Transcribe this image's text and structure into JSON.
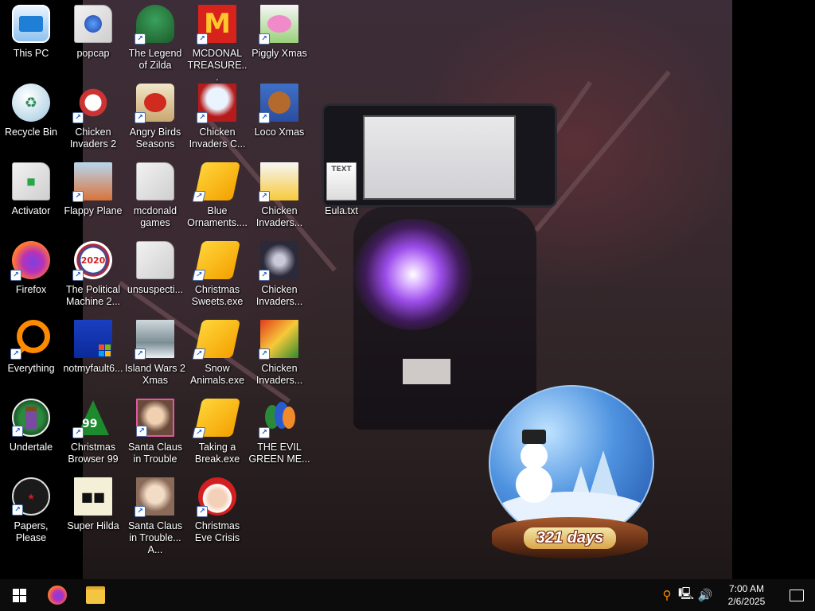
{
  "desktop": {
    "icons": [
      {
        "label": "This PC",
        "icon": "computer-icon"
      },
      {
        "label": "Recycle Bin",
        "icon": "recycle-bin-icon"
      },
      {
        "label": "Activator",
        "icon": "file-icon"
      },
      {
        "label": "Firefox",
        "icon": "firefox-icon"
      },
      {
        "label": "Everything",
        "icon": "search-icon"
      },
      {
        "label": "Undertale",
        "icon": "game-icon"
      },
      {
        "label": "Papers, Please",
        "icon": "game-icon"
      },
      {
        "label": "popcap",
        "icon": "file-icon"
      },
      {
        "label": "Chicken Invaders 2",
        "icon": "game-icon"
      },
      {
        "label": "Flappy Plane",
        "icon": "game-icon"
      },
      {
        "label": "The Political Machine 2...",
        "icon": "game-icon"
      },
      {
        "label": "notmyfault6...",
        "icon": "app-icon"
      },
      {
        "label": "Christmas Browser 99",
        "icon": "tree-icon"
      },
      {
        "label": "Super Hilda",
        "icon": "game-icon"
      },
      {
        "label": "The Legend of Zilda",
        "icon": "game-icon"
      },
      {
        "label": "Angry Birds Seasons",
        "icon": "game-icon"
      },
      {
        "label": "mcdonald games",
        "icon": "folder-icon"
      },
      {
        "label": "unsuspecti...",
        "icon": "folder-icon"
      },
      {
        "label": "Island Wars 2 Xmas",
        "icon": "game-icon"
      },
      {
        "label": "Santa Claus in Trouble",
        "icon": "game-icon"
      },
      {
        "label": "Santa Claus in Trouble... A...",
        "icon": "game-icon"
      },
      {
        "label": "MCDONAL TREASURE...",
        "icon": "mcdonalds-icon"
      },
      {
        "label": "Chicken Invaders C...",
        "icon": "game-icon"
      },
      {
        "label": "Blue Ornaments....",
        "icon": "installer-icon"
      },
      {
        "label": "Christmas Sweets.exe",
        "icon": "installer-icon"
      },
      {
        "label": "Snow Animals.exe",
        "icon": "installer-icon"
      },
      {
        "label": "Taking a Break.exe",
        "icon": "installer-icon"
      },
      {
        "label": "Christmas Eve Crisis",
        "icon": "santa-icon"
      },
      {
        "label": "Piggly Xmas",
        "icon": "game-icon"
      },
      {
        "label": "Loco Xmas",
        "icon": "game-icon"
      },
      {
        "label": "Chicken Invaders...",
        "icon": "game-icon"
      },
      {
        "label": "Chicken Invaders...",
        "icon": "game-icon"
      },
      {
        "label": "Chicken Invaders...",
        "icon": "game-icon"
      },
      {
        "label": "THE EVIL GREEN ME...",
        "icon": "app-icon"
      },
      {
        "label": "Eula.txt",
        "icon": "text-file-icon"
      }
    ]
  },
  "widget": {
    "countdown": "321 days"
  },
  "taskbar": {
    "start": "start-icon",
    "pinned": [
      "firefox-icon",
      "file-explorer-icon"
    ],
    "tray": {
      "time": "7:00 AM",
      "date": "2/6/2025"
    }
  },
  "colors": {
    "taskbar": "#0c0c0c",
    "accent_text": "#ffffff"
  }
}
